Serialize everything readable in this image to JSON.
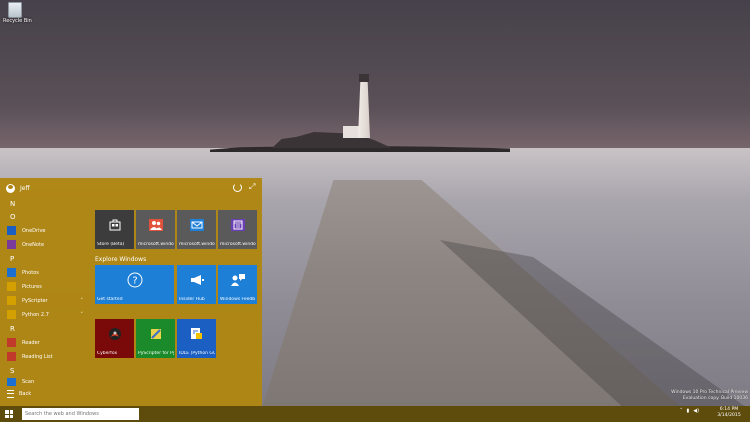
{
  "desktop": {
    "icons": [
      {
        "label": "Recycle Bin",
        "icon": "recycle-bin-icon"
      }
    ],
    "watermark": [
      "Windows 10 Pro Technical Preview",
      "Evaluation copy. Build 10036"
    ]
  },
  "start_menu": {
    "user": "Jeff",
    "back_label": "Back",
    "sections": [
      {
        "letter": "N",
        "items": []
      },
      {
        "letter": "O",
        "items": [
          {
            "label": "OneDrive",
            "color": "#1a5fc1"
          },
          {
            "label": "OneNote",
            "color": "#7a3a9a"
          }
        ]
      },
      {
        "letter": "P",
        "items": [
          {
            "label": "Photos",
            "color": "#1a6fd0"
          },
          {
            "label": "Pictures",
            "color": "#d4a000"
          },
          {
            "label": "PyScripter",
            "color": "#d4a000",
            "expandable": true
          },
          {
            "label": "Python 2.7",
            "color": "#d4a000",
            "expandable": true
          }
        ]
      },
      {
        "letter": "R",
        "items": [
          {
            "label": "Reader",
            "color": "#c0392b"
          },
          {
            "label": "Reading List",
            "color": "#c0392b"
          }
        ]
      },
      {
        "letter": "S",
        "items": [
          {
            "label": "Scan",
            "color": "#1a6fd0"
          }
        ]
      }
    ],
    "explore_label": "Explore Windows",
    "tiles": [
      {
        "label": "Store (Beta)",
        "color": "#3c3c3c",
        "icon": "store-icon"
      },
      {
        "label": "microsoft.windo",
        "color": "#5a5a5a",
        "icon": "people-icon"
      },
      {
        "label": "microsoft.windo",
        "color": "#5a5a5a",
        "icon": "mail-icon"
      },
      {
        "label": "microsoft.windo",
        "color": "#5a5a5a",
        "icon": "calendar-icon"
      },
      {
        "label": "Get started",
        "color": "#1e7fd6",
        "icon": "question-icon"
      },
      {
        "label": "Insider Hub",
        "color": "#1e7fd6",
        "icon": "megaphone-icon"
      },
      {
        "label": "Windows Feedb",
        "color": "#1e7fd6",
        "icon": "feedback-icon"
      },
      {
        "label": "Cyberfox",
        "color": "#7a0a0a",
        "icon": "cyberfox-icon"
      },
      {
        "label": "PyScripter for Py",
        "color": "#1a8a2a",
        "icon": "pyscripter-icon"
      },
      {
        "label": "IDLE (Python GU",
        "color": "#1a5fc1",
        "icon": "idle-icon"
      }
    ]
  },
  "taskbar": {
    "search_placeholder": "Search the web and Windows",
    "time": "6:14 PM",
    "date": "3/14/2015"
  }
}
